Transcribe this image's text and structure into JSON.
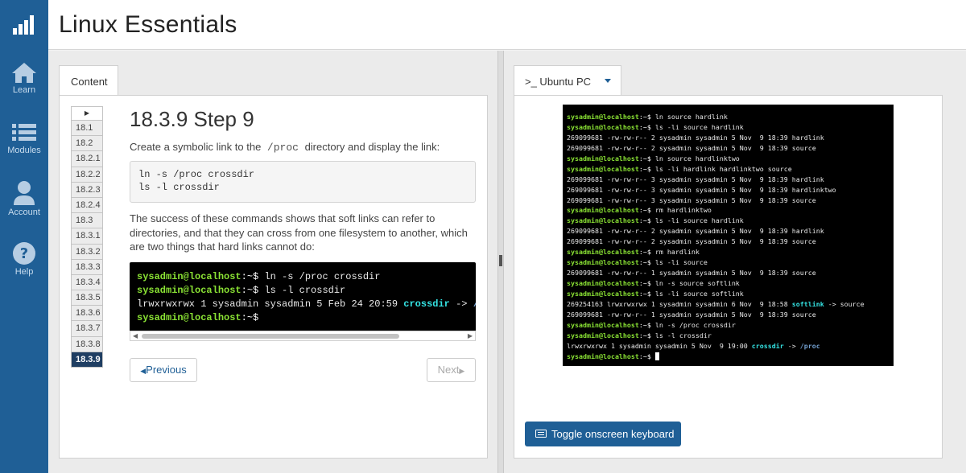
{
  "app": {
    "title": "Linux Essentials"
  },
  "nav": {
    "items": [
      {
        "label": "Learn",
        "icon": "home-icon"
      },
      {
        "label": "Modules",
        "icon": "list-icon"
      },
      {
        "label": "Account",
        "icon": "user-icon"
      },
      {
        "label": "Help",
        "icon": "question-icon"
      }
    ]
  },
  "content_tab": {
    "label": "Content"
  },
  "steps": {
    "items": [
      "18.1",
      "18.2",
      "18.2.1",
      "18.2.2",
      "18.2.3",
      "18.2.4",
      "18.3",
      "18.3.1",
      "18.3.2",
      "18.3.3",
      "18.3.4",
      "18.3.5",
      "18.3.6",
      "18.3.7",
      "18.3.8",
      "18.3.9"
    ],
    "active": "18.3.9"
  },
  "lesson": {
    "title": "18.3.9 Step 9",
    "intro_before": "Create a symbolic link to the",
    "intro_code": "/proc",
    "intro_after": "directory and display the link:",
    "commands": [
      "ln -s /proc crossdir",
      "ls -l crossdir"
    ],
    "explanation": "The success of these commands shows that soft links can refer to directories, and that they can cross from one filesystem to another, which are two things that hard links cannot do:",
    "output": {
      "prompt": "sysadmin@localhost",
      "line1_cmd": "ln -s /proc crossdir",
      "line2_cmd": "ls -l crossdir",
      "line3_text": "lrwxrwxrwx 1 sysadmin sysadmin 5 Feb 24 20:59 ",
      "line3_link": "crossdir",
      "line3_arrow": " -> ",
      "line3_target": "/"
    }
  },
  "buttons": {
    "previous": "Previous",
    "next": "Next",
    "keyboard": "Toggle onscreen keyboard"
  },
  "vm_tab": {
    "label": ">_ Ubuntu PC"
  },
  "vm_terminal": {
    "prompt": "sysadmin@localhost",
    "lines": [
      {
        "p": true,
        "t": "ln source hardlink"
      },
      {
        "p": true,
        "t": "ls -li source hardlink"
      },
      {
        "p": false,
        "t": "269099681 -rw-rw-r-- 2 sysadmin sysadmin 5 Nov  9 18:39 hardlink"
      },
      {
        "p": false,
        "t": "269099681 -rw-rw-r-- 2 sysadmin sysadmin 5 Nov  9 18:39 source"
      },
      {
        "p": true,
        "t": "ln source hardlinktwo"
      },
      {
        "p": true,
        "t": "ls -li hardlink hardlinktwo source"
      },
      {
        "p": false,
        "t": "269099681 -rw-rw-r-- 3 sysadmin sysadmin 5 Nov  9 18:39 hardlink"
      },
      {
        "p": false,
        "t": "269099681 -rw-rw-r-- 3 sysadmin sysadmin 5 Nov  9 18:39 hardlinktwo"
      },
      {
        "p": false,
        "t": "269099681 -rw-rw-r-- 3 sysadmin sysadmin 5 Nov  9 18:39 source"
      },
      {
        "p": true,
        "t": "rm hardlinktwo"
      },
      {
        "p": true,
        "t": "ls -li source hardlink"
      },
      {
        "p": false,
        "t": "269099681 -rw-rw-r-- 2 sysadmin sysadmin 5 Nov  9 18:39 hardlink"
      },
      {
        "p": false,
        "t": "269099681 -rw-rw-r-- 2 sysadmin sysadmin 5 Nov  9 18:39 source"
      },
      {
        "p": true,
        "t": "rm hardlink"
      },
      {
        "p": true,
        "t": "ls -li source"
      },
      {
        "p": false,
        "t": "269099681 -rw-rw-r-- 1 sysadmin sysadmin 5 Nov  9 18:39 source"
      },
      {
        "p": true,
        "t": "ln -s source softlink"
      },
      {
        "p": true,
        "t": "ls -li source softlink"
      },
      {
        "p": false,
        "t": "269254163 lrwxrwxrwx 1 sysadmin sysadmin 6 Nov  9 18:58 ",
        "link": "softlink",
        "after": " -> source"
      },
      {
        "p": false,
        "t": "269099681 -rw-rw-r-- 1 sysadmin sysadmin 5 Nov  9 18:39 source"
      },
      {
        "p": true,
        "t": "ln -s /proc crossdir"
      },
      {
        "p": true,
        "t": "ls -l crossdir"
      },
      {
        "p": false,
        "t": "lrwxrwxrwx 1 sysadmin sysadmin 5 Nov  9 19:00 ",
        "link": "crossdir",
        "after": " -> ",
        "target": "/proc"
      },
      {
        "p": true,
        "t": "",
        "cursor": true
      }
    ]
  },
  "colors": {
    "nav": "#1f5f96",
    "prompt": "#8ae234",
    "link": "#34e2e2",
    "dir": "#729fcf",
    "active_step": "#1f3e62"
  }
}
